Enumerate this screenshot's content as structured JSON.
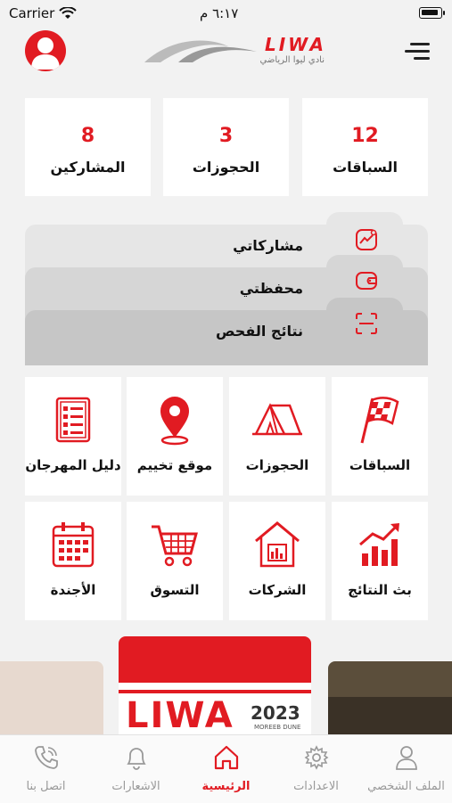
{
  "status_bar": {
    "carrier": "Carrier",
    "time": "٦:١٧ م"
  },
  "header": {
    "logo_text": "LIWA",
    "logo_subtitle": "نادي ليوا الرياضي"
  },
  "stats": [
    {
      "value": "12",
      "label": "السباقات"
    },
    {
      "value": "3",
      "label": "الحجوزات"
    },
    {
      "value": "8",
      "label": "المشاركين"
    }
  ],
  "dropdowns": [
    {
      "label": "مشاركاتي",
      "icon": "chart-icon"
    },
    {
      "label": "محفظتي",
      "icon": "wallet-icon"
    },
    {
      "label": "نتائج الفحص",
      "icon": "scan-icon"
    }
  ],
  "grid": [
    {
      "label": "السباقات",
      "icon": "checkered-flag-icon"
    },
    {
      "label": "الحجوزات",
      "icon": "tent-icon"
    },
    {
      "label": "موقع تخييم",
      "icon": "location-pin-icon"
    },
    {
      "label": "دليل المهرجان",
      "icon": "checklist-icon"
    },
    {
      "label": "بث النتائج",
      "icon": "bar-chart-up-icon"
    },
    {
      "label": "الشركات",
      "icon": "building-icon"
    },
    {
      "label": "التسوق",
      "icon": "shopping-cart-icon"
    },
    {
      "label": "الأجندة",
      "icon": "calendar-icon"
    }
  ],
  "banner": {
    "title": "LIWA",
    "year": "2023",
    "subtitle": "MOREEB DUNE"
  },
  "tabs": [
    {
      "label": "الملف الشخصي",
      "icon": "person-icon"
    },
    {
      "label": "الاعدادات",
      "icon": "gear-icon"
    },
    {
      "label": "الرئيسية",
      "icon": "home-icon",
      "active": true
    },
    {
      "label": "الاشعارات",
      "icon": "bell-icon"
    },
    {
      "label": "اتصل بنا",
      "icon": "phone-icon"
    }
  ],
  "colors": {
    "accent": "#e11b22",
    "background": "#f2f2f2"
  }
}
